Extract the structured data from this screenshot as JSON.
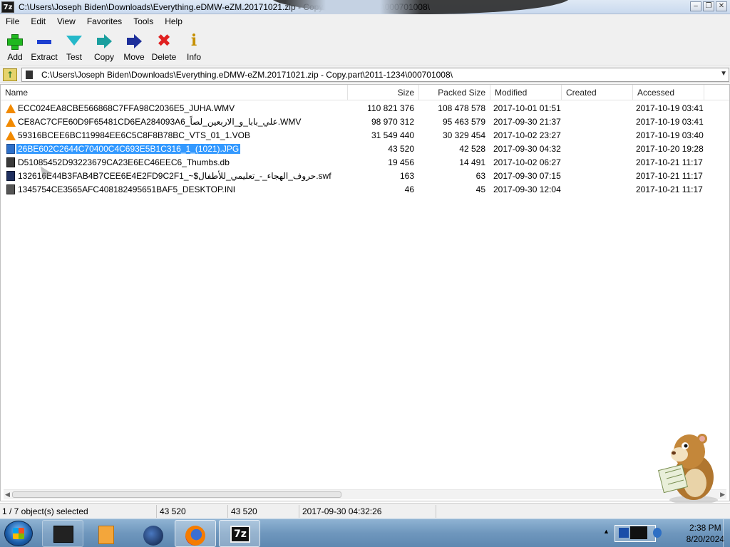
{
  "window": {
    "title": "C:\\Users\\Joseph Biden\\Downloads\\Everything.eDMW-eZM.20171021.zip - Copy.part\\2011-1234\\000701008\\",
    "app_icon": "7z"
  },
  "menu": [
    "File",
    "Edit",
    "View",
    "Favorites",
    "Tools",
    "Help"
  ],
  "toolbar": {
    "add": "Add",
    "extract": "Extract",
    "test": "Test",
    "copy": "Copy",
    "move": "Move",
    "delete": "Delete",
    "info": "Info"
  },
  "address": {
    "path": "C:\\Users\\Joseph Biden\\Downloads\\Everything.eDMW-eZM.20171021.zip - Copy.part\\2011-1234\\000701008\\"
  },
  "columns": {
    "name": "Name",
    "size": "Size",
    "packed": "Packed Size",
    "modified": "Modified",
    "created": "Created",
    "accessed": "Accessed"
  },
  "files": [
    {
      "icon": "vlc-icon",
      "name": "ECC024EA8CBE566868C7FFA98C2036E5_JUHA.WMV",
      "size": "110 821 376",
      "packed": "108 478 578",
      "modified": "2017-10-01 01:51",
      "accessed": "2017-10-19 03:41"
    },
    {
      "icon": "vlc-icon",
      "name": "CE8AC7CFE60D9F65481CD6EA284093A6_علي_بابا_و_الاربعين_لصاً.WMV",
      "size": "98 970 312",
      "packed": "95 463 579",
      "modified": "2017-09-30 21:37",
      "accessed": "2017-10-19 03:41"
    },
    {
      "icon": "vlc-icon",
      "name": "59316BCEE6BC119984EE6C5C8F8B78BC_VTS_01_1.VOB",
      "size": "31 549 440",
      "packed": "30 329 454",
      "modified": "2017-10-02 23:27",
      "accessed": "2017-10-19 03:40"
    },
    {
      "icon": "image-icon",
      "name": "26BE602C2644C70400C4C693E5B1C316_1_(1021).JPG",
      "size": "43 520",
      "packed": "42 528",
      "modified": "2017-09-30 04:32",
      "accessed": "2017-10-20 19:28",
      "selected": true
    },
    {
      "icon": "db-file-icon",
      "name": "D51085452D93223679CA23E6EC46EEC6_Thumbs.db",
      "size": "19 456",
      "packed": "14 491",
      "modified": "2017-10-02 06:27",
      "accessed": "2017-10-21 11:17"
    },
    {
      "icon": "flash-file-icon",
      "name": "132616E44B3FAB4B7CEE6E4E2FD9C2F1_~$حروف_الهجاء_-_تعليمي_للأطفال.swf",
      "size": "163",
      "packed": "63",
      "modified": "2017-09-30 07:15",
      "accessed": "2017-10-21 11:17"
    },
    {
      "icon": "ini-file-icon",
      "name": "1345754CE3565AFC408182495651BAF5_DESKTOP.INI",
      "size": "46",
      "packed": "45",
      "modified": "2017-09-30 12:04",
      "accessed": "2017-10-21 11:17"
    }
  ],
  "status": {
    "selection": "1 / 7 object(s) selected",
    "size": "43 520",
    "packed": "43 520",
    "modified": "2017-09-30 04:32:26"
  },
  "taskbar": {
    "time": "2:38 PM",
    "date": "8/20/2024",
    "tray_arrow": "▲"
  },
  "colors": {
    "selection": "#3399ff",
    "vlc_orange": "#f28a00",
    "add_green": "#1fb81f",
    "delete_red": "#e02020"
  }
}
